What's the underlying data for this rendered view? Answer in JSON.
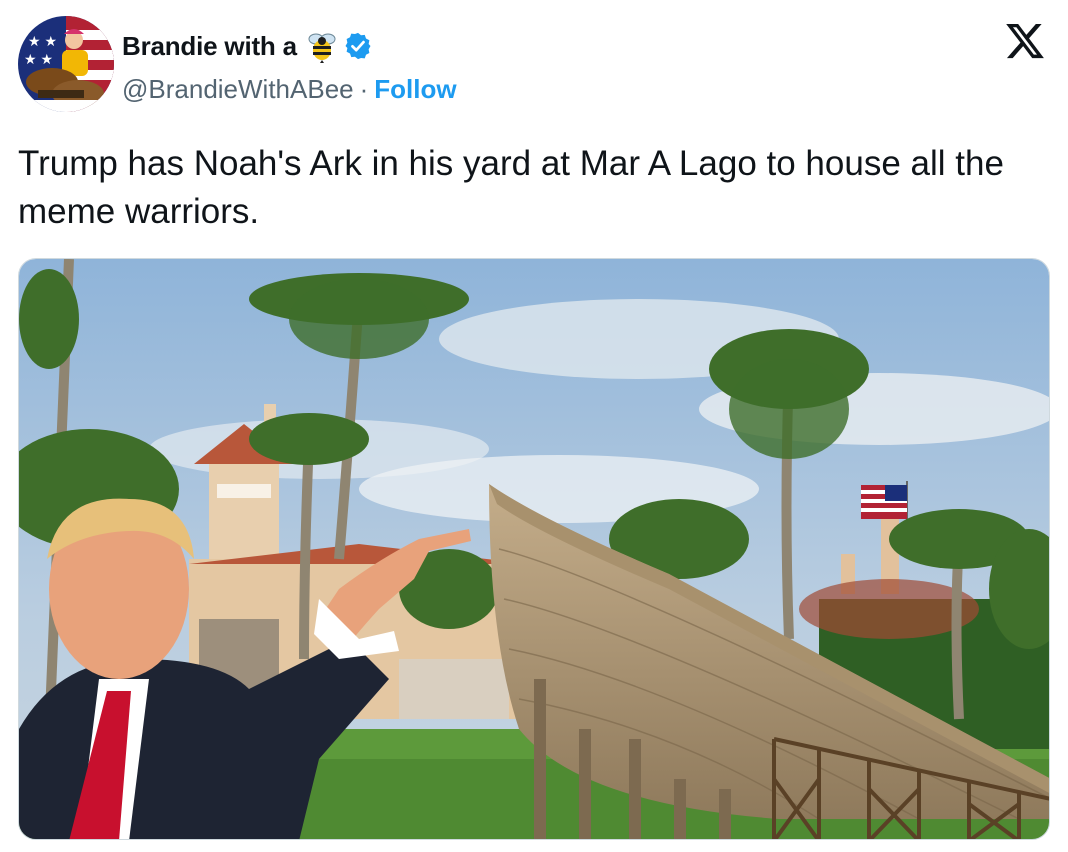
{
  "tweet": {
    "display_name": "Brandie with a",
    "handle": "@BrandieWithABee",
    "separator": "·",
    "follow_label": "Follow",
    "text": "Trump has Noah's Ark in his yard at Mar A Lago to house all the meme warriors."
  },
  "icons": {
    "avatar": "avatar",
    "bee": "bee-icon",
    "verified": "verified-badge-icon",
    "platform": "x-logo-icon"
  },
  "colors": {
    "accent": "#1d9bf0",
    "text": "#0f1419",
    "secondary": "#536471"
  }
}
